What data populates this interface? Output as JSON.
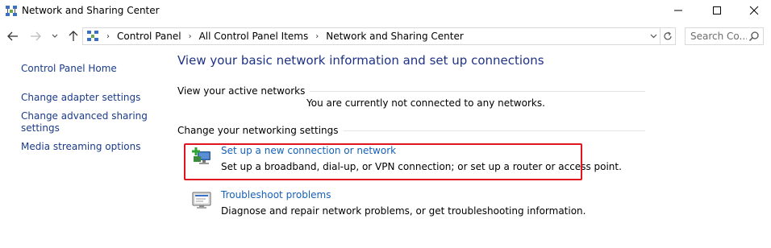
{
  "window": {
    "title": "Network and Sharing Center"
  },
  "address_bar": {
    "breadcrumbs": [
      "Control Panel",
      "All Control Panel Items",
      "Network and Sharing Center"
    ]
  },
  "search": {
    "placeholder": "Search Co..."
  },
  "sidebar": {
    "items": [
      {
        "label": "Control Panel Home"
      },
      {
        "label": "Change adapter settings"
      },
      {
        "label": "Change advanced sharing settings"
      },
      {
        "label": "Media streaming options"
      }
    ]
  },
  "main": {
    "title": "View your basic network information and set up connections",
    "active_networks": {
      "heading": "View your active networks",
      "status": "You are currently not connected to any networks."
    },
    "change_settings": {
      "heading": "Change your networking settings",
      "tasks": [
        {
          "label": "Set up a new connection or network",
          "description": "Set up a broadband, dial-up, or VPN connection; or set up a router or access point.",
          "icon": "new-connection-icon",
          "highlighted": true
        },
        {
          "label": "Troubleshoot problems",
          "description": "Diagnose and repair network problems, or get troubleshooting information.",
          "icon": "troubleshoot-icon",
          "highlighted": false
        }
      ]
    }
  },
  "colors": {
    "link": "#1660b8",
    "title": "#1e3287",
    "highlight": "#e0141e"
  }
}
